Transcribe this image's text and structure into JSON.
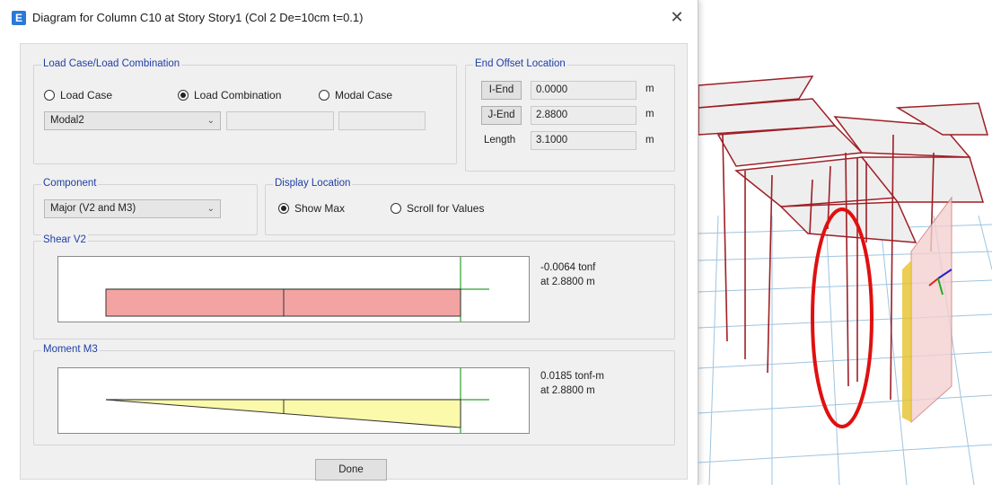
{
  "dialog": {
    "title": "Diagram for Column C10 at Story Story1 (Col 2 De=10cm t=0.1)",
    "app_icon_letter": "E",
    "close_glyph": "✕"
  },
  "load_case": {
    "group_title": "Load Case/Load Combination",
    "options": [
      "Load Case",
      "Load Combination",
      "Modal Case"
    ],
    "selected_option": "Load Combination",
    "selected_value": "Modal2",
    "extra_field_1": "",
    "extra_field_2": ""
  },
  "end_offset": {
    "group_title": "End Offset Location",
    "i_end_label": "I-End",
    "i_end_value": "0.0000",
    "j_end_label": "J-End",
    "j_end_value": "2.8800",
    "length_label": "Length",
    "length_value": "3.1000",
    "unit": "m"
  },
  "component": {
    "group_title": "Component",
    "selected_value": "Major (V2 and M3)"
  },
  "display_location": {
    "group_title": "Display Location",
    "options": [
      "Show Max",
      "Scroll for Values"
    ],
    "selected_option": "Show Max"
  },
  "shear": {
    "group_title": "Shear V2",
    "value_text": "-0.0064 tonf",
    "location_text": "at 2.8800 m",
    "fill_color": "#f4a3a3"
  },
  "moment": {
    "group_title": "Moment M3",
    "value_text": "0.0185 tonf-m",
    "location_text": "at 2.8800 m",
    "fill_color": "#fafaaa"
  },
  "footer": {
    "done_label": "Done"
  },
  "colors": {
    "group_title": "#1f3fa6",
    "highlight_ellipse": "#e01010",
    "frame_member": "#9e1f26",
    "slab": "#eeeeee",
    "grid": "#9ec4e0"
  }
}
